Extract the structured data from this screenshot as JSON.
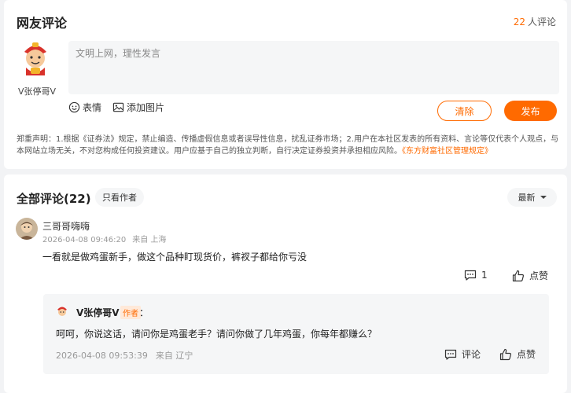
{
  "header": {
    "title": "网友评论",
    "count_num": "22",
    "count_label": "人评论"
  },
  "composer": {
    "username": "V张停哥V",
    "placeholder": "文明上网，理性发言",
    "emoji_label": "表情",
    "image_label": "添加图片",
    "clear_label": "清除",
    "post_label": "发布"
  },
  "disclaimer": {
    "text": "郑重声明：1.根据《证券法》规定，禁止编造、传播虚假信息或者误导性信息，扰乱证券市场；2.用户在本社区发表的所有资料、言论等仅代表个人观点，与本网站立场无关，不对您构成任何投资建议。用户应基于自己的独立判断，自行决定证券投资并承担相应风险。",
    "rule_link": "《东方财富社区管理规定》"
  },
  "comments_section": {
    "title": "全部评论(22)",
    "author_only": "只看作者",
    "sort_label": "最新"
  },
  "comment": {
    "name": "三哥哥嗨嗨",
    "time": "2026-04-08 09:46:20",
    "location": "来自 上海",
    "content": "一看就是做鸡蛋新手，做这个品种盯现货价，裤衩子都给你亏没",
    "reply_count": "1",
    "like_label": "点赞"
  },
  "reply": {
    "name": "V张停哥V",
    "badge": "作者",
    "colon": "：",
    "content": "呵呵，你说这话，请问你是鸡蛋老手？请问你做了几年鸡蛋，你每年都赚么？",
    "time": "2026-04-08 09:53:39",
    "location": "来自 辽宁",
    "reply_label": "评论",
    "like_label": "点赞"
  },
  "colors": {
    "accent": "#ff6a00",
    "background": "#f2f3f5"
  },
  "icons": [
    "emoji-icon",
    "image-icon",
    "caret-down-icon",
    "comment-icon",
    "thumbs-up-icon"
  ]
}
